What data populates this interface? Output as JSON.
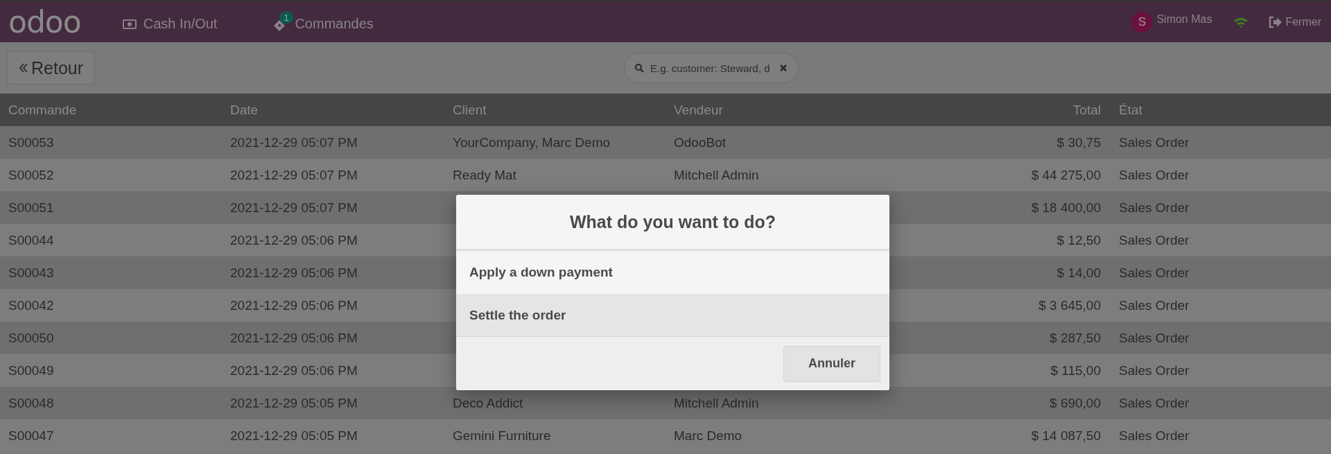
{
  "topbar": {
    "logo": "odoo",
    "items": [
      {
        "kind": "cash",
        "label": "Cash In/Out"
      },
      {
        "kind": "orders",
        "label": "Commandes",
        "badge": "1"
      }
    ],
    "user": {
      "initial": "S",
      "name": "Simon Mas"
    },
    "close": "Fermer"
  },
  "controls": {
    "back": "Retour",
    "search": {
      "placeholder": "E.g. customer: Steward, d"
    }
  },
  "table": {
    "columns": [
      "Commande",
      "Date",
      "Client",
      "Vendeur",
      "Total",
      "État"
    ],
    "rows": [
      {
        "order": "S00053",
        "date": "2021-12-29 05:07 PM",
        "client": "YourCompany, Marc Demo",
        "seller": "OdooBot",
        "total": "$ 30,75",
        "state": "Sales Order"
      },
      {
        "order": "S00052",
        "date": "2021-12-29 05:07 PM",
        "client": "Ready Mat",
        "seller": "Mitchell Admin",
        "total": "$ 44 275,00",
        "state": "Sales Order"
      },
      {
        "order": "S00051",
        "date": "2021-12-29 05:07 PM",
        "total": "$ 18 400,00",
        "state": "Sales Order"
      },
      {
        "order": "S00044",
        "date": "2021-12-29 05:06 PM",
        "total": "$ 12,50",
        "state": "Sales Order"
      },
      {
        "order": "S00043",
        "date": "2021-12-29 05:06 PM",
        "total": "$ 14,00",
        "state": "Sales Order"
      },
      {
        "order": "S00042",
        "date": "2021-12-29 05:06 PM",
        "total": "$ 3 645,00",
        "state": "Sales Order"
      },
      {
        "order": "S00050",
        "date": "2021-12-29 05:06 PM",
        "total": "$ 287,50",
        "state": "Sales Order"
      },
      {
        "order": "S00049",
        "date": "2021-12-29 05:06 PM",
        "total": "$ 115,00",
        "state": "Sales Order"
      },
      {
        "order": "S00048",
        "date": "2021-12-29 05:05 PM",
        "client": "Deco Addict",
        "seller": "Mitchell Admin",
        "total": "$ 690,00",
        "state": "Sales Order"
      },
      {
        "order": "S00047",
        "date": "2021-12-29 05:05 PM",
        "client": "Gemini Furniture",
        "seller": "Marc Demo",
        "total": "$ 14 087,50",
        "state": "Sales Order"
      }
    ]
  },
  "dialog": {
    "title": "What do you want to do?",
    "options": [
      {
        "label": "Apply a down payment",
        "selected": false
      },
      {
        "label": "Settle the order",
        "selected": true
      }
    ],
    "cancel": "Annuler"
  }
}
